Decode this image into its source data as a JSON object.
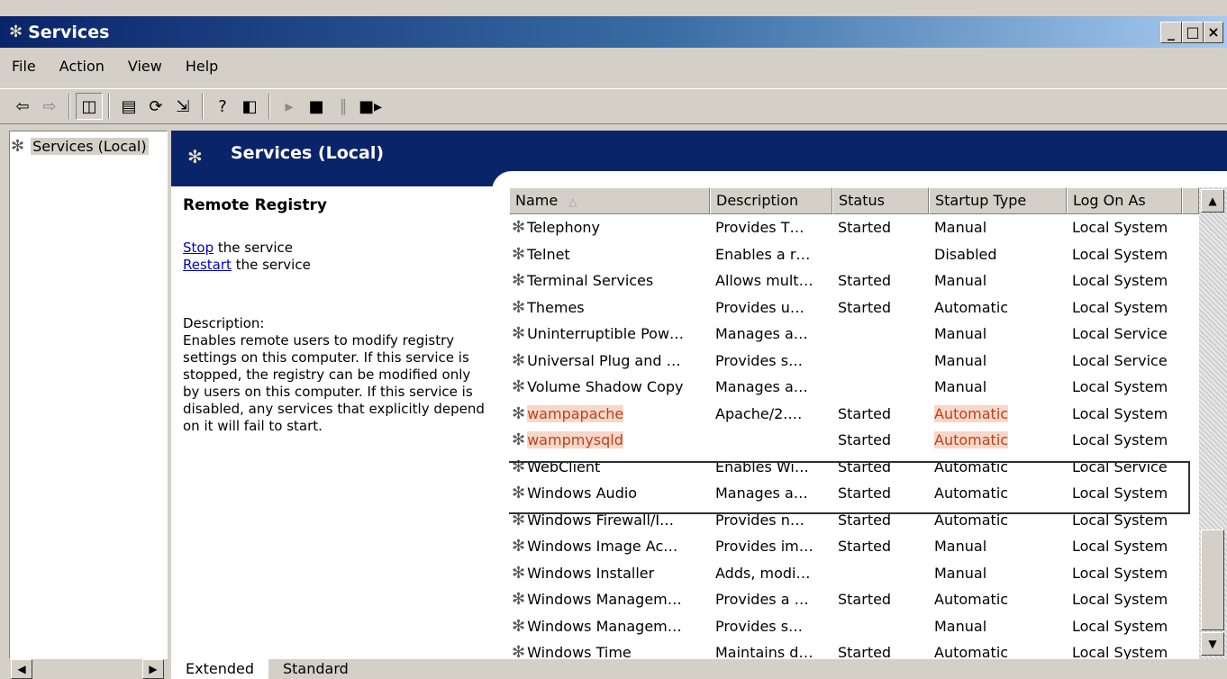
{
  "window": {
    "title": "Services"
  },
  "menu": [
    "File",
    "Action",
    "View",
    "Help"
  ],
  "toolbar": {
    "buttons": [
      "back-icon",
      "forward-icon",
      "show-hide-tree-icon",
      "properties-icon",
      "refresh-icon",
      "export-list-icon",
      "help-icon",
      "console-icon",
      "play-icon",
      "stop-icon",
      "pause-icon",
      "restart-icon"
    ]
  },
  "tree": {
    "root_label": "Services (Local)"
  },
  "banner": {
    "title": "Services (Local)"
  },
  "details": {
    "service_name": "Remote Registry",
    "stop_link": "Stop",
    "stop_suffix": " the service",
    "restart_link": "Restart",
    "restart_suffix": " the service",
    "description_label": "Description:",
    "description_text": "Enables remote users to modify registry settings on this computer. If this service is stopped, the registry can be modified only by users on this computer. If this service is disabled, any services that explicitly depend on it will fail to start."
  },
  "list": {
    "headers": [
      "Name",
      "Description",
      "Status",
      "Startup Type",
      "Log On As"
    ],
    "rows": [
      {
        "name": "Telephony",
        "description": "Provides T…",
        "status": "Started",
        "startup": "Manual",
        "logon": "Local System"
      },
      {
        "name": "Telnet",
        "description": "Enables a r…",
        "status": "",
        "startup": "Disabled",
        "logon": "Local System"
      },
      {
        "name": "Terminal Services",
        "description": "Allows mult…",
        "status": "Started",
        "startup": "Manual",
        "logon": "Local System"
      },
      {
        "name": "Themes",
        "description": "Provides u…",
        "status": "Started",
        "startup": "Automatic",
        "logon": "Local System"
      },
      {
        "name": "Uninterruptible Pow…",
        "description": "Manages a…",
        "status": "",
        "startup": "Manual",
        "logon": "Local Service"
      },
      {
        "name": "Universal Plug and …",
        "description": "Provides s…",
        "status": "",
        "startup": "Manual",
        "logon": "Local Service"
      },
      {
        "name": "Volume Shadow Copy",
        "description": "Manages a…",
        "status": "",
        "startup": "Manual",
        "logon": "Local System"
      },
      {
        "name": "wampapache",
        "description": "Apache/2.…",
        "status": "Started",
        "startup": "Automatic",
        "logon": "Local System"
      },
      {
        "name": "wampmysqld",
        "description": "",
        "status": "Started",
        "startup": "Automatic",
        "logon": "Local System"
      },
      {
        "name": "WebClient",
        "description": "Enables Wi…",
        "status": "Started",
        "startup": "Automatic",
        "logon": "Local Service"
      },
      {
        "name": "Windows Audio",
        "description": "Manages a…",
        "status": "Started",
        "startup": "Automatic",
        "logon": "Local System"
      },
      {
        "name": "Windows Firewall/I…",
        "description": "Provides n…",
        "status": "Started",
        "startup": "Automatic",
        "logon": "Local System"
      },
      {
        "name": "Windows Image Ac…",
        "description": "Provides im…",
        "status": "Started",
        "startup": "Manual",
        "logon": "Local System"
      },
      {
        "name": "Windows Installer",
        "description": "Adds, modi…",
        "status": "",
        "startup": "Manual",
        "logon": "Local System"
      },
      {
        "name": "Windows Managem…",
        "description": "Provides a …",
        "status": "Started",
        "startup": "Automatic",
        "logon": "Local System"
      },
      {
        "name": "Windows Managem…",
        "description": "Provides s…",
        "status": "",
        "startup": "Manual",
        "logon": "Local System"
      },
      {
        "name": "Windows Time",
        "description": "Maintains d…",
        "status": "Started",
        "startup": "Automatic",
        "logon": "Local System"
      }
    ],
    "highlighted_rows": [
      7,
      8
    ]
  },
  "tabs": [
    "Extended",
    "Standard"
  ],
  "colors": {
    "title_bar": "#0a246a",
    "banner": "#0a246a",
    "highlight_text": "#c04020",
    "highlight_bg": "#f6d8c8",
    "link": "#0000cc"
  }
}
